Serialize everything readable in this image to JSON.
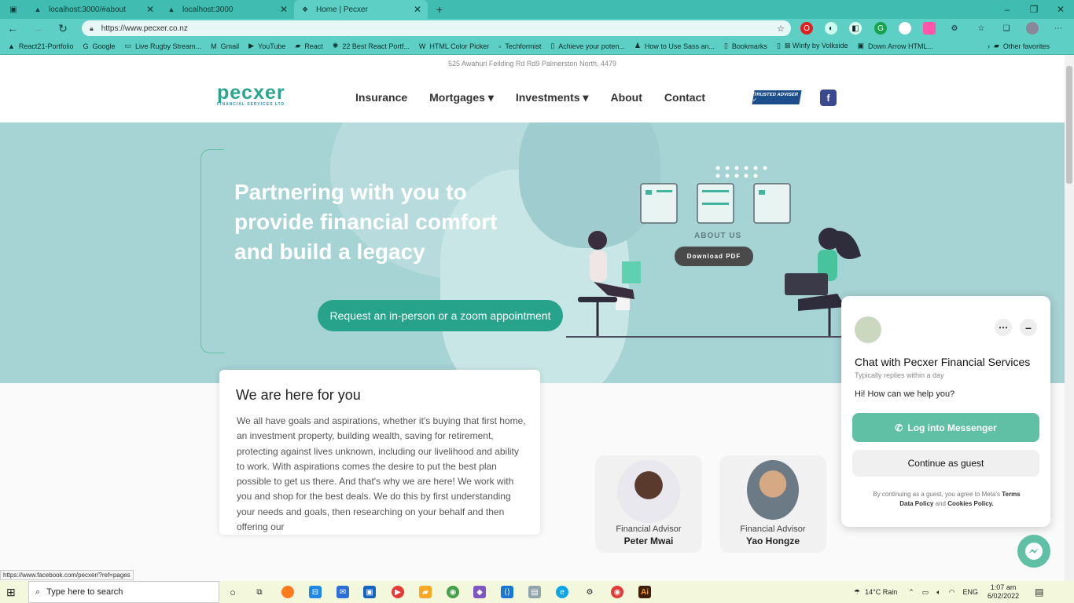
{
  "browser": {
    "tabs": [
      {
        "title": "localhost:3000/#about",
        "icon": "triangle-icon"
      },
      {
        "title": "localhost:3000",
        "icon": "triangle-icon"
      },
      {
        "title": "Home | Pecxer",
        "icon": "site-icon",
        "active": true
      }
    ],
    "new_tab": "+",
    "url": "https://www.pecxer.co.nz",
    "bookmarks": [
      {
        "label": "React21-Portfolio",
        "icon": "▲"
      },
      {
        "label": "Google",
        "icon": "G"
      },
      {
        "label": "Live Rugby Stream...",
        "icon": "▭"
      },
      {
        "label": "Gmail",
        "icon": "M"
      },
      {
        "label": "YouTube",
        "icon": "▶"
      },
      {
        "label": "React",
        "icon": "▰"
      },
      {
        "label": "22 Best React Portf...",
        "icon": "✺"
      },
      {
        "label": "HTML Color Picker",
        "icon": "W"
      },
      {
        "label": "Techformist",
        "icon": "▫"
      },
      {
        "label": "Achieve your poten...",
        "icon": "▯"
      },
      {
        "label": "How to Use Sass an...",
        "icon": "♟"
      },
      {
        "label": "Bookmarks",
        "icon": "▯"
      },
      {
        "label": "⊠ Winfy by Volkside",
        "icon": "▯"
      },
      {
        "label": "Down Arrow HTML...",
        "icon": "▣"
      }
    ],
    "other_favorites": "Other favorites"
  },
  "site": {
    "address": "525 Awahuri Feilding Rd Rd9 Palmerston North, 4479",
    "logo_main": "pecxer",
    "logo_sub": "FINANCIAL SERVICES LTD",
    "nav": [
      "Insurance",
      "Mortgages ▾",
      "Investments ▾",
      "About",
      "Contact"
    ],
    "badge": "TRUSTED ADVISER ✓",
    "facebook": "f",
    "headline": "Partnering with you to provide financial comfort and build a legacy",
    "cta": "Request an in-person or a zoom appointment",
    "about_us": "ABOUT US",
    "download_pdf": "Download PDF",
    "section_title": "We are here for you",
    "section_body": "We all have goals and aspirations, whether it's buying that first home, an investment property, building wealth, saving for retirement, protecting against lives unknown, including our livelihood and ability to work. With aspirations comes the desire to put the best plan possible to get us there. And that's why we are here! We work with you and shop for the best deals. We do this by first understanding your needs and goals, then researching on your behalf and then offering our",
    "advisors": [
      {
        "role": "Financial Advisor",
        "name": "Peter Mwai"
      },
      {
        "role": "Financial Advisor",
        "name": "Yao Hongze"
      }
    ]
  },
  "chat": {
    "title": "Chat with Pecxer Financial Services",
    "subtitle": "Typically replies within a day",
    "greeting": "Hi! How can we help you?",
    "login": "Log into Messenger",
    "guest": "Continue as guest",
    "legal_prefix": "By continuing as a guest, you agree to Meta's",
    "terms": "Terms",
    "data_policy": "Data Policy",
    "and": "and",
    "cookies": "Cookies Policy."
  },
  "status_url": "https://www.facebook.com/pecxer/?ref=pages",
  "taskbar": {
    "search": "Type here to search",
    "weather": "14°C  Rain",
    "lang": "ENG",
    "time": "1:07 am",
    "date": "6/02/2022"
  },
  "colors": {
    "teal": "#26a38a",
    "browser": "#5ecfc4",
    "hero": "#a6d3d4"
  }
}
